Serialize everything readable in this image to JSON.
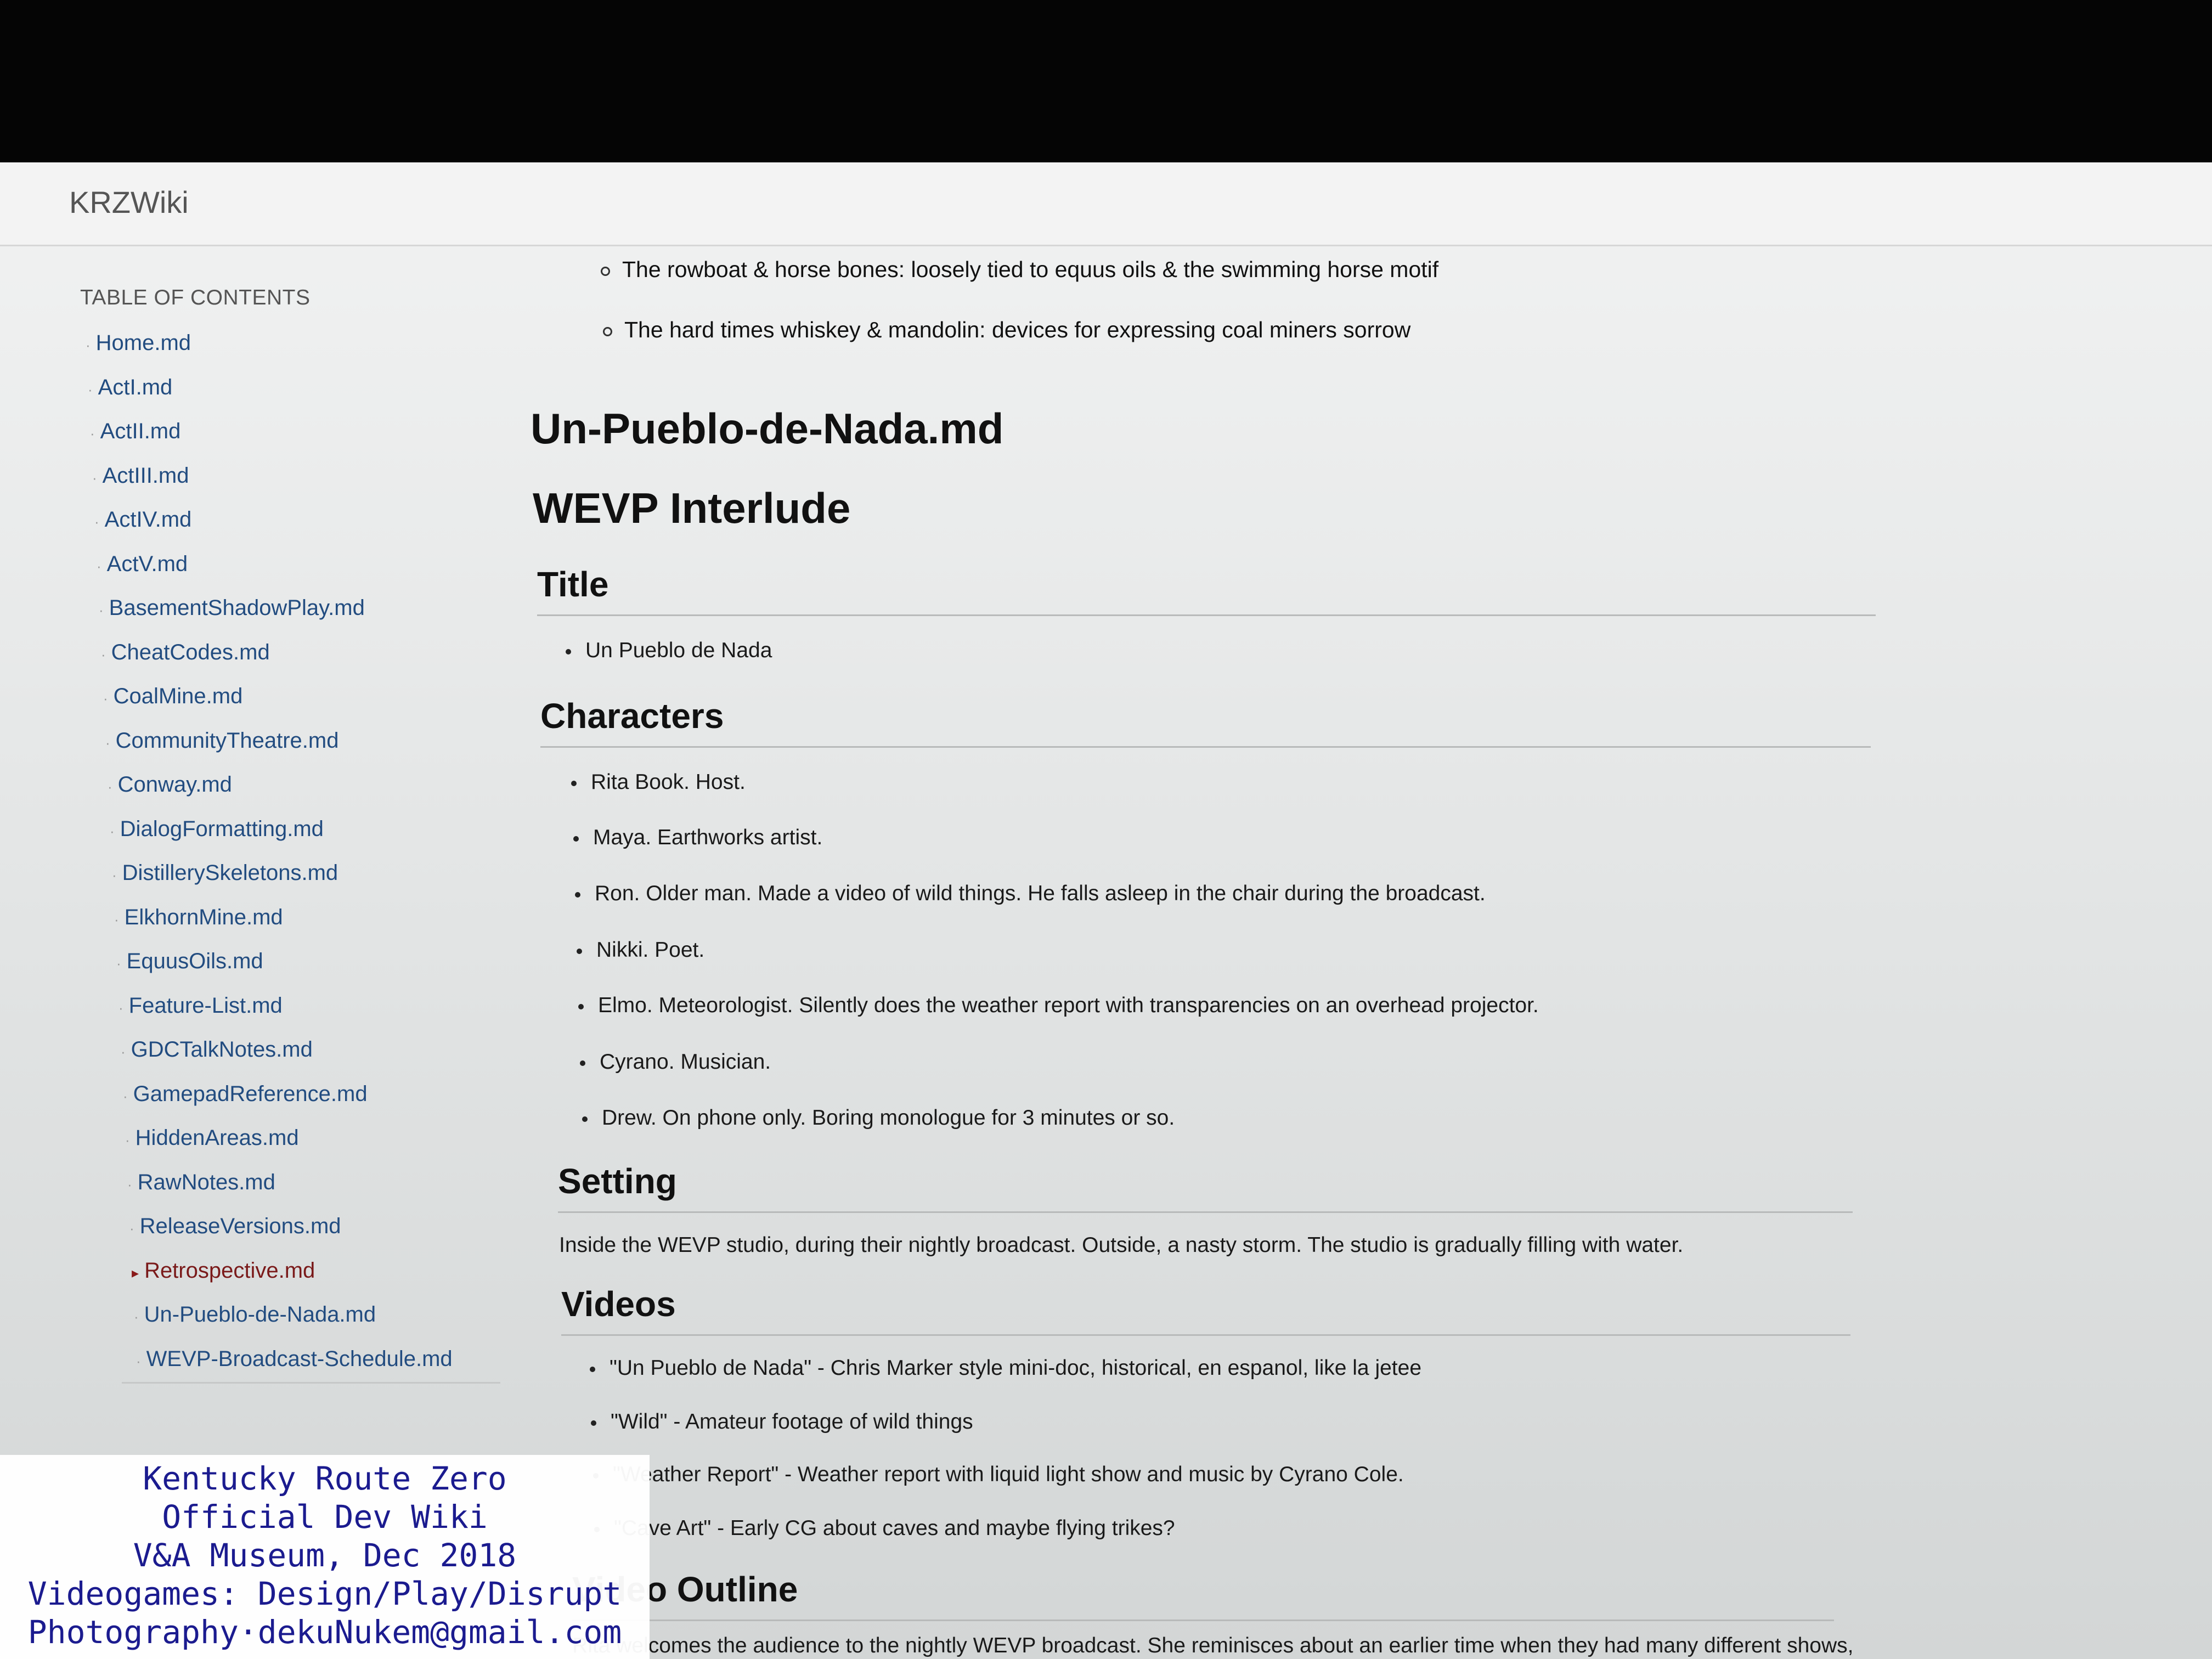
{
  "app": {
    "brand": "KRZWiki"
  },
  "sidebar": {
    "header": "TABLE OF CONTENTS",
    "items": [
      {
        "label": "Home.md"
      },
      {
        "label": "ActI.md"
      },
      {
        "label": "ActII.md"
      },
      {
        "label": "ActIII.md"
      },
      {
        "label": "ActIV.md"
      },
      {
        "label": "ActV.md"
      },
      {
        "label": "BasementShadowPlay.md"
      },
      {
        "label": "CheatCodes.md"
      },
      {
        "label": "CoalMine.md"
      },
      {
        "label": "CommunityTheatre.md"
      },
      {
        "label": "Conway.md"
      },
      {
        "label": "DialogFormatting.md"
      },
      {
        "label": "DistillerySkeletons.md"
      },
      {
        "label": "ElkhornMine.md"
      },
      {
        "label": "EquusOils.md"
      },
      {
        "label": "Feature-List.md"
      },
      {
        "label": "GDCTalkNotes.md"
      },
      {
        "label": "GamepadReference.md"
      },
      {
        "label": "HiddenAreas.md"
      },
      {
        "label": "RawNotes.md"
      },
      {
        "label": "ReleaseVersions.md"
      },
      {
        "label": "Retrospective.md"
      },
      {
        "label": "Un-Pueblo-de-Nada.md"
      },
      {
        "label": "WEVP-Broadcast-Schedule.md"
      }
    ],
    "active_index": 21
  },
  "content": {
    "top_bullets": [
      "The rowboat & horse bones: loosely tied to equus oils & the swimming horse motif",
      "The hard times whiskey & mandolin: devices for expressing coal miners sorrow"
    ],
    "page_title": "Un-Pueblo-de-Nada.md",
    "doc_title": "WEVP Interlude",
    "sections": {
      "title": {
        "heading": "Title",
        "items": [
          "Un Pueblo de Nada"
        ]
      },
      "characters": {
        "heading": "Characters",
        "items": [
          "Rita Book. Host.",
          "Maya. Earthworks artist.",
          "Ron. Older man. Made a video of wild things. He falls asleep in the chair during the broadcast.",
          "Nikki. Poet.",
          "Elmo. Meteorologist. Silently does the weather report with transparencies on an overhead projector.",
          "Cyrano. Musician.",
          "Drew. On phone only. Boring monologue for 3 minutes or so."
        ]
      },
      "setting": {
        "heading": "Setting",
        "text": "Inside the WEVP studio, during their nightly broadcast. Outside, a nasty storm. The studio is gradually filling with water."
      },
      "videos": {
        "heading": "Videos",
        "items": [
          "\"Un Pueblo de Nada\" - Chris Marker style mini-doc, historical, en espanol, like la jetee",
          "\"Wild\" - Amateur footage of wild things",
          "\"Weather Report\" - Weather report with liquid light show and music by Cyrano Cole.",
          "\"Cave Art\" - Early CG about caves and maybe flying trikes?"
        ]
      },
      "outline": {
        "heading": "Video Outline",
        "text": "Rita welcomes the audience to the nightly WEVP broadcast. She reminisces about an earlier time when they had many different shows,"
      }
    }
  },
  "watermark": {
    "lines": [
      "Kentucky Route Zero",
      "Official Dev Wiki",
      "V&A Museum, Dec 2018",
      "Videogames: Design/Play/Disrupt",
      "Photography·dekuNukem@gmail.com"
    ]
  }
}
